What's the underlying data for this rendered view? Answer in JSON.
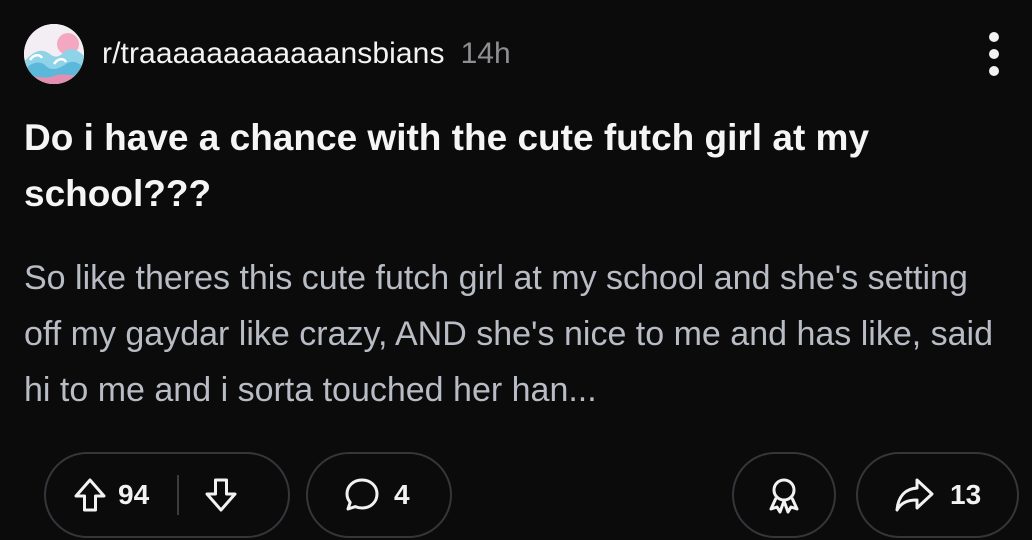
{
  "post": {
    "subreddit": "r/traaaaaaaaaaaansbians",
    "age": "14h",
    "title": "Do i have a chance with the cute futch girl at my school???",
    "body_preview": "So like theres this cute futch girl at my school and she's setting off my gaydar like crazy, AND she's nice to me and has like, said hi to me and i sorta touched her han..."
  },
  "actions": {
    "upvote_count": "94",
    "comment_count": "4",
    "share_count": "13"
  },
  "icons": {
    "avatar": "wave-painting-avatar",
    "more": "vertical-ellipsis-icon",
    "upvote": "arrow-up-icon",
    "downvote": "arrow-down-icon",
    "comment": "speech-bubble-icon",
    "award": "award-icon",
    "share": "share-arrow-icon"
  },
  "colors": {
    "background": "#0b0b0c",
    "title": "#f5f5f5",
    "body": "#b8bcc4",
    "muted": "#8e8e93",
    "pill_border": "#34363a"
  }
}
